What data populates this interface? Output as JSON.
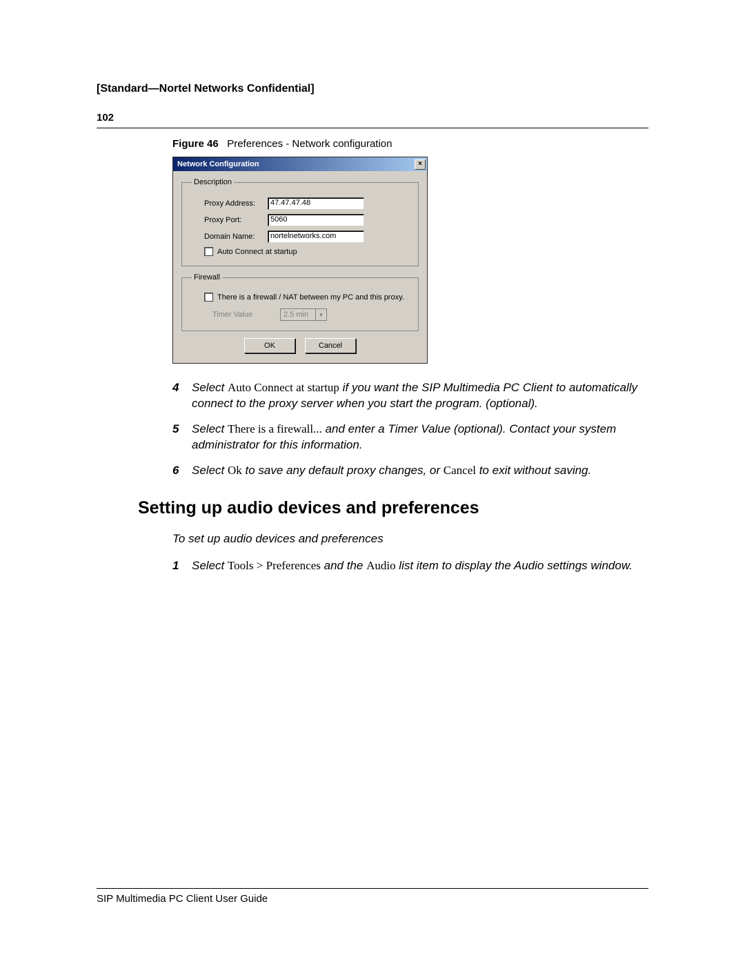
{
  "header": {
    "confidential": "[Standard—Nortel Networks Confidential]",
    "page_number": "102"
  },
  "figure": {
    "label": "Figure 46",
    "caption": "Preferences - Network configuration"
  },
  "dialog": {
    "title": "Network Configuration",
    "close": "×",
    "description_legend": "Description",
    "proxy_address_label": "Proxy Address:",
    "proxy_address_value": "47.47.47.48",
    "proxy_port_label": "Proxy Port:",
    "proxy_port_value": "5060",
    "domain_name_label": "Domain Name:",
    "domain_name_value": "nortelnetworks.com",
    "auto_connect_label": "Auto Connect at startup",
    "firewall_legend": "Firewall",
    "firewall_checkbox_label": "There is a firewall / NAT between my PC and this proxy.",
    "timer_label": "Timer Value",
    "timer_value": "2.5 min",
    "ok": "OK",
    "cancel": "Cancel"
  },
  "steps_a": [
    {
      "n": "4",
      "pre": "Select ",
      "bold": "Auto Connect at startup",
      "post": " if you want the SIP Multimedia PC Client to automatically connect to the proxy server when you start the program. (optional)."
    },
    {
      "n": "5",
      "pre": "Select ",
      "bold": "There is a firewall...",
      "post": " and enter a Timer Value (optional). Contact your system administrator for this information."
    }
  ],
  "step6": {
    "n": "6",
    "p1": "Select ",
    "ok": "Ok",
    "p2": " to save any default proxy changes, or ",
    "cancel": "Cancel",
    "p3": " to exit without saving."
  },
  "section_heading": "Setting up audio devices and preferences",
  "subheading": "To set up audio devices and preferences",
  "step1": {
    "n": "1",
    "p1": "Select ",
    "menu": "Tools > Preferences",
    "p2": " and the ",
    "item": "Audio",
    "p3": " list item to display the Audio settings window."
  },
  "footer": "SIP Multimedia PC Client User Guide"
}
